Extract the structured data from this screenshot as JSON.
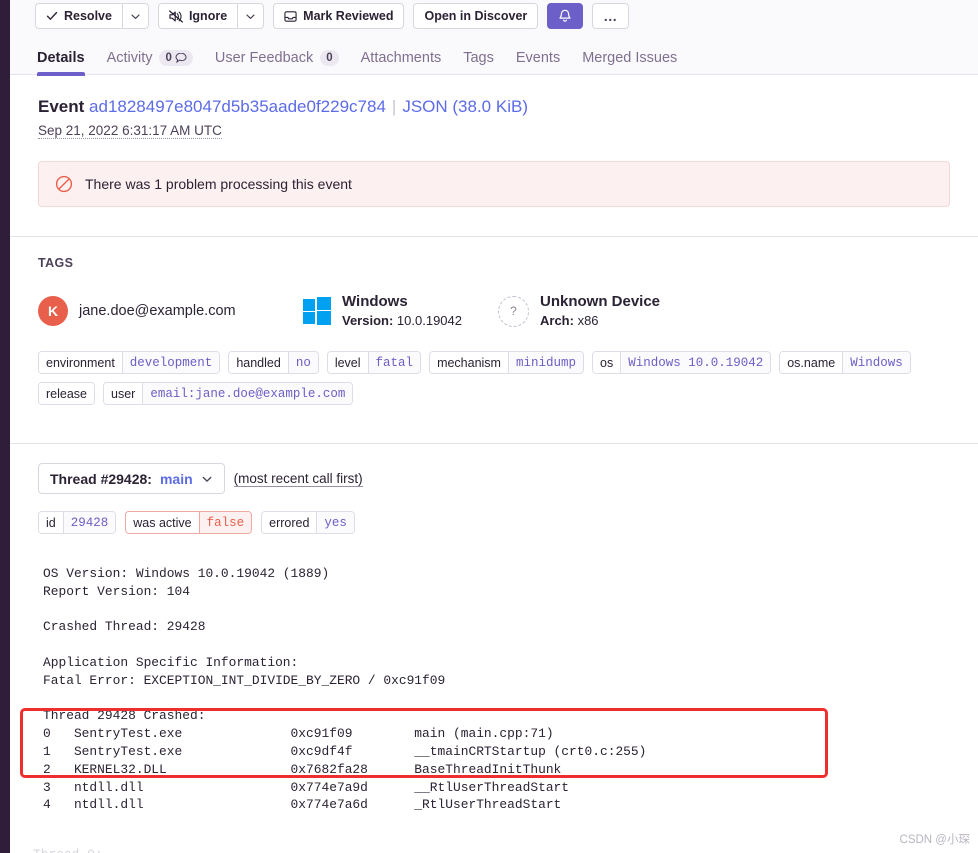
{
  "toolbar": {
    "resolve_label": "Resolve",
    "resolve_caret": "",
    "ignore_label": "Ignore",
    "ignore_caret": "",
    "mark_reviewed_label": "Mark Reviewed",
    "open_discover_label": "Open in Discover",
    "bell_label": "",
    "ellipsis_label": "…",
    "accent_color": "#6c5fc7"
  },
  "tabs": [
    {
      "label": "Details",
      "count": null,
      "active": true,
      "bubble": false
    },
    {
      "label": "Activity",
      "count": "0",
      "active": false,
      "bubble": true
    },
    {
      "label": "User Feedback",
      "count": "0",
      "active": false,
      "bubble": false
    },
    {
      "label": "Attachments",
      "count": null,
      "active": false,
      "bubble": false
    },
    {
      "label": "Tags",
      "count": null,
      "active": false,
      "bubble": false
    },
    {
      "label": "Events",
      "count": null,
      "active": false,
      "bubble": false
    },
    {
      "label": "Merged Issues",
      "count": null,
      "active": false,
      "bubble": false
    }
  ],
  "event": {
    "label": "Event",
    "id": "ad1828497e8047d5b35aade0f229c784",
    "separator": "|",
    "json_link": "JSON (38.0 KiB)",
    "timestamp": "Sep 21, 2022 6:31:17 AM UTC"
  },
  "banner": {
    "icon": "deny-icon",
    "message": "There was 1 problem processing this event",
    "bg_color": "#fdf0f0",
    "border_color": "#f5d7d7",
    "icon_color": "#e8604b"
  },
  "tags": {
    "title": "TAGS",
    "summary": [
      {
        "kind": "user",
        "avatar_letter": "K",
        "avatar_color": "#e8604b",
        "primary": "jane.doe@example.com",
        "secondary": "",
        "secondary_label": ""
      },
      {
        "kind": "os",
        "icon": "windows-logo-icon",
        "primary": "Windows",
        "secondary_label": "Version:",
        "secondary": "10.0.19042"
      },
      {
        "kind": "device",
        "icon": "unknown-device-icon",
        "icon_glyph": "?",
        "primary": "Unknown Device",
        "secondary_label": "Arch:",
        "secondary": "x86"
      }
    ],
    "pills": [
      {
        "key": "environment",
        "value": "development"
      },
      {
        "key": "handled",
        "value": "no"
      },
      {
        "key": "level",
        "value": "fatal"
      },
      {
        "key": "mechanism",
        "value": "minidump"
      },
      {
        "key": "os",
        "value": "Windows 10.0.19042"
      },
      {
        "key": "os.name",
        "value": "Windows"
      },
      {
        "key": "release",
        "value": null
      },
      {
        "key": "user",
        "value": "email:jane.doe@example.com"
      }
    ]
  },
  "thread": {
    "selector_label": "Thread #29428:",
    "selector_value": "main",
    "order_note": "(most recent call first)",
    "pills": [
      {
        "key": "id",
        "value": "29428",
        "state": "normal"
      },
      {
        "key": "was active",
        "value": "false",
        "state": "error"
      },
      {
        "key": "errored",
        "value": "yes",
        "state": "normal"
      }
    ]
  },
  "crash_report": {
    "lines": [
      "OS Version: Windows 10.0.19042 (1889)",
      "Report Version: 104",
      "",
      "Crashed Thread: 29428",
      "",
      "Application Specific Information:",
      "Fatal Error: EXCEPTION_INT_DIVIDE_BY_ZERO / 0xc91f09",
      "",
      "Thread 29428 Crashed:",
      "0   SentryTest.exe              0xc91f09        main (main.cpp:71)",
      "1   SentryTest.exe              0xc9df4f        __tmainCRTStartup (crt0.c:255)",
      "2   KERNEL32.DLL                0x7682fa28      BaseThreadInitThunk",
      "3   ntdll.dll                   0x774e7a9d      __RtlUserThreadStart",
      "4   ntdll.dll                   0x774e7a6d      _RtlUserThreadStart"
    ],
    "highlight_color": "#ef2f2f"
  },
  "watermark": "CSDN @小琛"
}
